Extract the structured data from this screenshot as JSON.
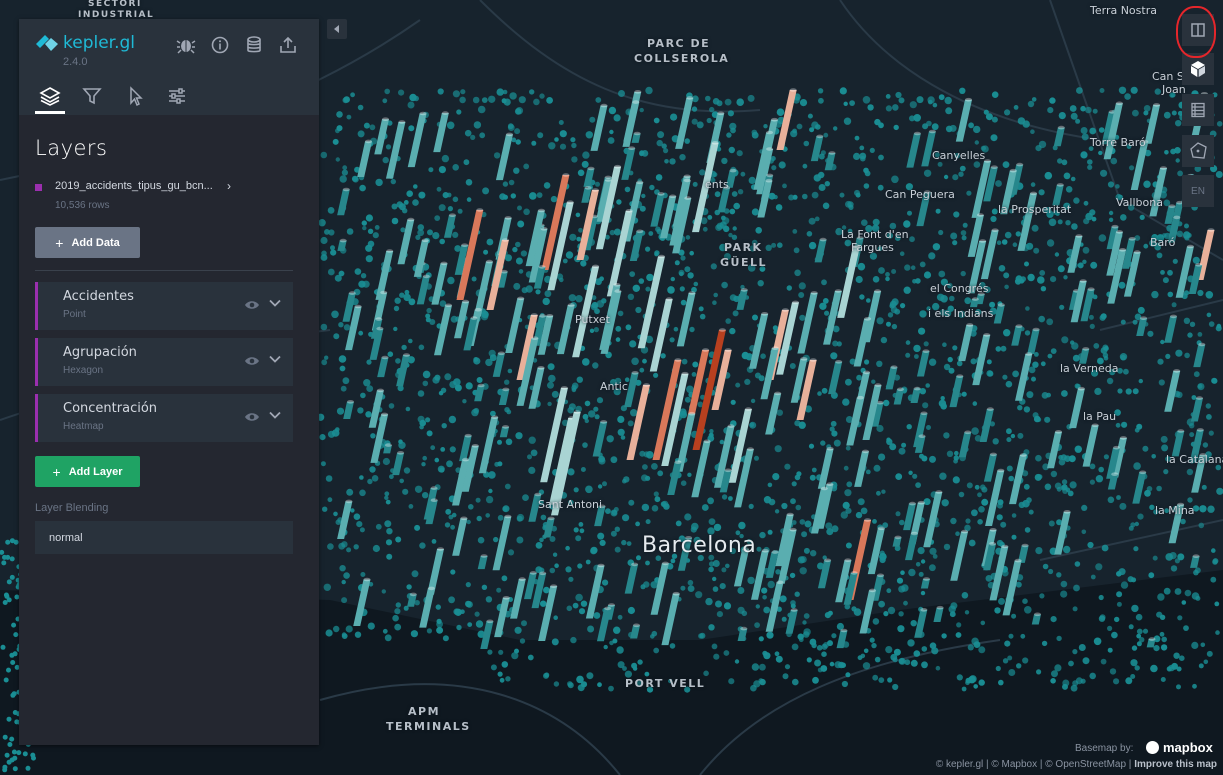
{
  "app": {
    "title": "kepler.gl",
    "version": "2.4.0",
    "brand_color": "#1fbad6",
    "header_icons": [
      "bug-icon",
      "info-icon",
      "database-icon",
      "share-icon"
    ],
    "tabs": [
      {
        "name": "layers",
        "icon": "layers-icon",
        "active": true
      },
      {
        "name": "filters",
        "icon": "filter-icon",
        "active": false
      },
      {
        "name": "interactions",
        "icon": "cursor-icon",
        "active": false
      },
      {
        "name": "base-map",
        "icon": "sliders-icon",
        "active": false
      }
    ]
  },
  "panel": {
    "title": "Layers",
    "dataset": {
      "name": "2019_accidents_tipus_gu_bcn...",
      "rows": "10,536 rows",
      "color": "#9b2fae"
    },
    "add_data_label": "Add Data",
    "add_layer_label": "Add Layer",
    "layers": [
      {
        "name": "Accidentes",
        "type": "Point"
      },
      {
        "name": "Agrupación",
        "type": "Hexagon"
      },
      {
        "name": "Concentración",
        "type": "Heatmap"
      }
    ],
    "blending": {
      "label": "Layer Blending",
      "value": "normal"
    }
  },
  "map_controls": [
    {
      "name": "split-map-icon",
      "highlighted": true
    },
    {
      "name": "3d-view-icon"
    },
    {
      "name": "legend-icon"
    },
    {
      "name": "draw-polygon-icon"
    },
    {
      "name": "language",
      "label": "EN"
    }
  ],
  "map": {
    "labels": {
      "sectori_1": "SECTORI",
      "sectori_2": "INDUSTRIAL",
      "parc_1": "PARC DE",
      "parc_2": "COLLSEROLA",
      "terra_nostra": "Terra Nostra",
      "can_sant_1": "Can St",
      "can_sant_2": "Joan",
      "torre_baro": "Torre Baró",
      "canyelles": "Canyelles",
      "ents": "ents",
      "can_peguera": "Can Peguera",
      "prosperitat": "la Prosperitat",
      "vallbona": "Vallbona",
      "font_1": "La Font d'en",
      "font_2": "Fargues",
      "park_1": "PARK",
      "park_2": "GÜELL",
      "baro": "Baró",
      "congres": "el Congrés",
      "indians": "i els Indians",
      "putxet": "Putxet",
      "verneda": "la Verneda",
      "pau": "la Pau",
      "antic": "Antic",
      "catalana": "la Catalana",
      "sant_antoni": "Sant Antoni",
      "mina": "la Mina",
      "barcelona": "Barcelona",
      "port_vell": "PORT VELL",
      "apm_1": "APM",
      "apm_2": "TERMINALS"
    },
    "hex_color": "#1a8e94",
    "column_colors": [
      "#27878c",
      "#5aaeb0",
      "#a9d4d3",
      "#e8b09a",
      "#d9785a",
      "#b8401f"
    ]
  },
  "attribution": {
    "basemap_by": "Basemap by:",
    "mapbox": "mapbox",
    "text_kepler": "© kepler.gl",
    "text_mapbox": "© Mapbox",
    "text_osm": "© OpenStreetMap",
    "improve": "Improve this map"
  }
}
